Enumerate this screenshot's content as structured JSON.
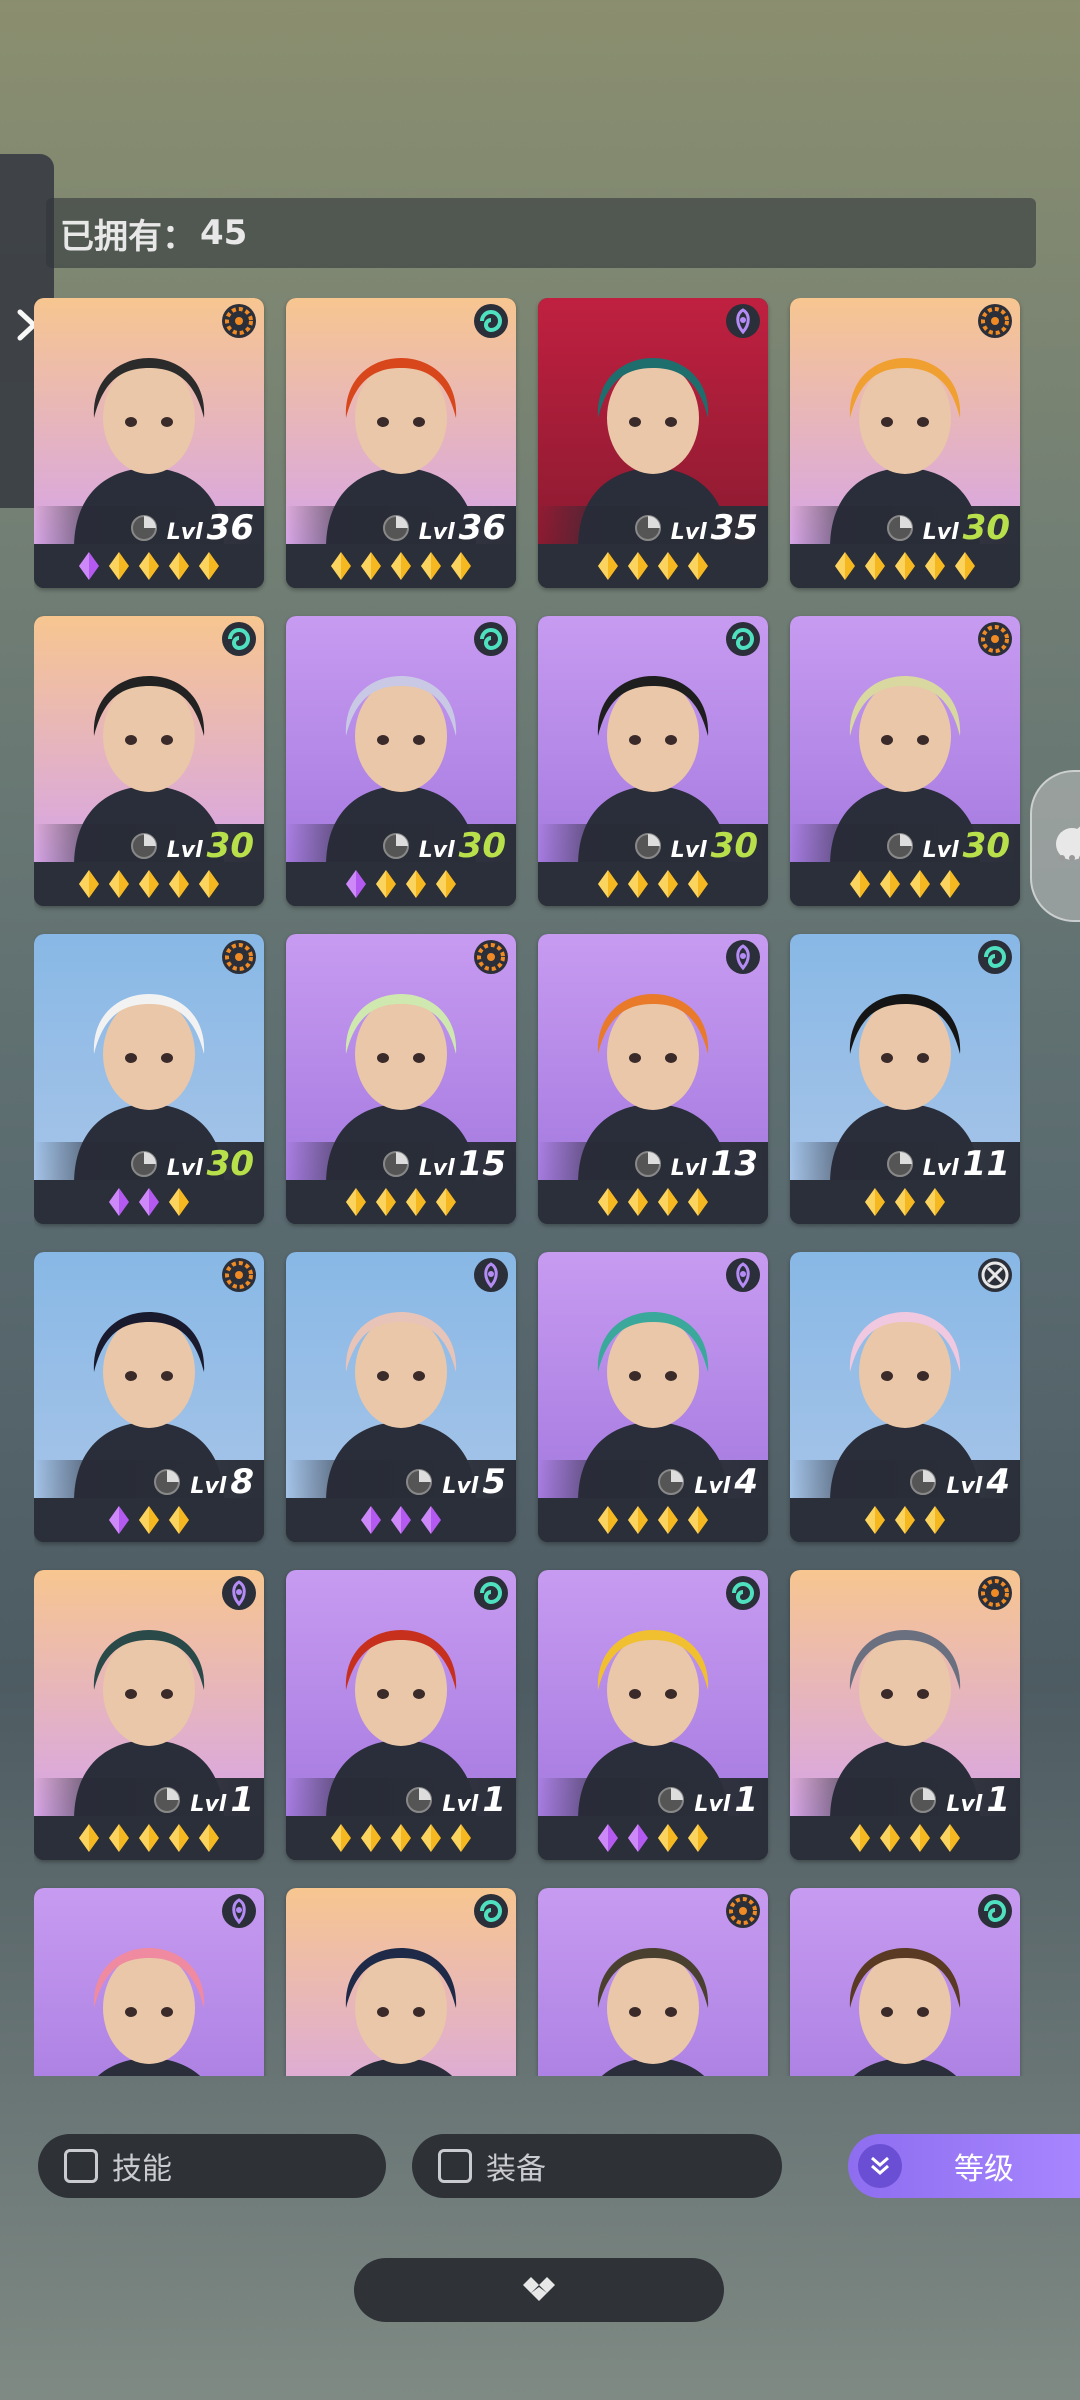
{
  "header": {
    "owned_label": "已拥有：",
    "owned_count": "45"
  },
  "level_label": "Lvl",
  "colors": {
    "accent": "#a886ff",
    "level_green": "#b8e04a",
    "card_bg": "#2b2f39"
  },
  "heroes": [
    {
      "level": 36,
      "class": "warrior",
      "stars": [
        "purple",
        "gold",
        "gold",
        "gold",
        "gold"
      ],
      "bg": "warm",
      "hair": "#2b2b2b",
      "green": false
    },
    {
      "level": 36,
      "class": "mystic",
      "stars": [
        "gold",
        "gold",
        "gold",
        "gold",
        "gold"
      ],
      "bg": "warm",
      "hair": "#d8461c",
      "green": false
    },
    {
      "level": 35,
      "class": "psychic",
      "stars": [
        "gold",
        "gold",
        "gold",
        "gold"
      ],
      "bg": "red",
      "hair": "#1f6e6e",
      "green": false
    },
    {
      "level": 30,
      "class": "warrior",
      "stars": [
        "gold",
        "gold",
        "gold",
        "gold",
        "gold"
      ],
      "bg": "warm",
      "hair": "#f0a030",
      "green": true
    },
    {
      "level": 30,
      "class": "mystic",
      "stars": [
        "gold",
        "gold",
        "gold",
        "gold",
        "gold"
      ],
      "bg": "warm",
      "hair": "#222",
      "green": true
    },
    {
      "level": 30,
      "class": "mystic",
      "stars": [
        "purple",
        "gold",
        "gold",
        "gold"
      ],
      "bg": "purple",
      "hair": "#c9c9e6",
      "green": true
    },
    {
      "level": 30,
      "class": "mystic",
      "stars": [
        "gold",
        "gold",
        "gold",
        "gold"
      ],
      "bg": "purple",
      "hair": "#1e1e1e",
      "green": true
    },
    {
      "level": 30,
      "class": "warrior",
      "stars": [
        "gold",
        "gold",
        "gold",
        "gold"
      ],
      "bg": "purple",
      "hair": "#d8d8a0",
      "green": true
    },
    {
      "level": 30,
      "class": "warrior",
      "stars": [
        "purple",
        "purple",
        "gold"
      ],
      "bg": "blue",
      "hair": "#f2f2f2",
      "green": true
    },
    {
      "level": 15,
      "class": "warrior",
      "stars": [
        "gold",
        "gold",
        "gold",
        "gold"
      ],
      "bg": "purple",
      "hair": "#cfe8b0",
      "green": false
    },
    {
      "level": 13,
      "class": "psychic",
      "stars": [
        "gold",
        "gold",
        "gold",
        "gold"
      ],
      "bg": "purple",
      "hair": "#e87a2a",
      "green": false
    },
    {
      "level": 11,
      "class": "mystic",
      "stars": [
        "gold",
        "gold",
        "gold"
      ],
      "bg": "blue",
      "hair": "#151515",
      "green": false
    },
    {
      "level": 8,
      "class": "warrior",
      "stars": [
        "purple",
        "gold",
        "gold"
      ],
      "bg": "blue",
      "hair": "#1a1a2e",
      "green": false
    },
    {
      "level": 5,
      "class": "psychic",
      "stars": [
        "purple",
        "purple",
        "purple"
      ],
      "bg": "blue",
      "hair": "#e8c4b8",
      "green": false
    },
    {
      "level": 4,
      "class": "psychic",
      "stars": [
        "gold",
        "gold",
        "gold",
        "gold"
      ],
      "bg": "purple",
      "hair": "#3aa89a",
      "green": false
    },
    {
      "level": 4,
      "class": "cross",
      "stars": [
        "gold",
        "gold",
        "gold"
      ],
      "bg": "blue",
      "hair": "#f0c8e0",
      "green": false
    },
    {
      "level": 1,
      "class": "psychic",
      "stars": [
        "gold",
        "gold",
        "gold",
        "gold",
        "gold"
      ],
      "bg": "warm",
      "hair": "#2a4a4a",
      "green": false
    },
    {
      "level": 1,
      "class": "mystic",
      "stars": [
        "gold",
        "gold",
        "gold",
        "gold",
        "gold"
      ],
      "bg": "purple",
      "hair": "#c8301e",
      "green": false
    },
    {
      "level": 1,
      "class": "mystic",
      "stars": [
        "purple",
        "purple",
        "gold",
        "gold"
      ],
      "bg": "purple",
      "hair": "#f0c030",
      "green": false
    },
    {
      "level": 1,
      "class": "warrior",
      "stars": [
        "gold",
        "gold",
        "gold",
        "gold"
      ],
      "bg": "warm",
      "hair": "#6a7080",
      "green": false
    },
    {
      "level": null,
      "class": "psychic",
      "stars": [],
      "bg": "purple",
      "hair": "#f08aa0",
      "green": false
    },
    {
      "level": null,
      "class": "mystic",
      "stars": [],
      "bg": "warm",
      "hair": "#1e2a48",
      "green": false
    },
    {
      "level": null,
      "class": "warrior",
      "stars": [],
      "bg": "purple",
      "hair": "#4a4030",
      "green": false
    },
    {
      "level": null,
      "class": "mystic",
      "stars": [],
      "bg": "purple",
      "hair": "#5a3a22",
      "green": false
    }
  ],
  "filters": {
    "skill_label": "技能",
    "equip_label": "装备",
    "sort_label": "等级"
  }
}
